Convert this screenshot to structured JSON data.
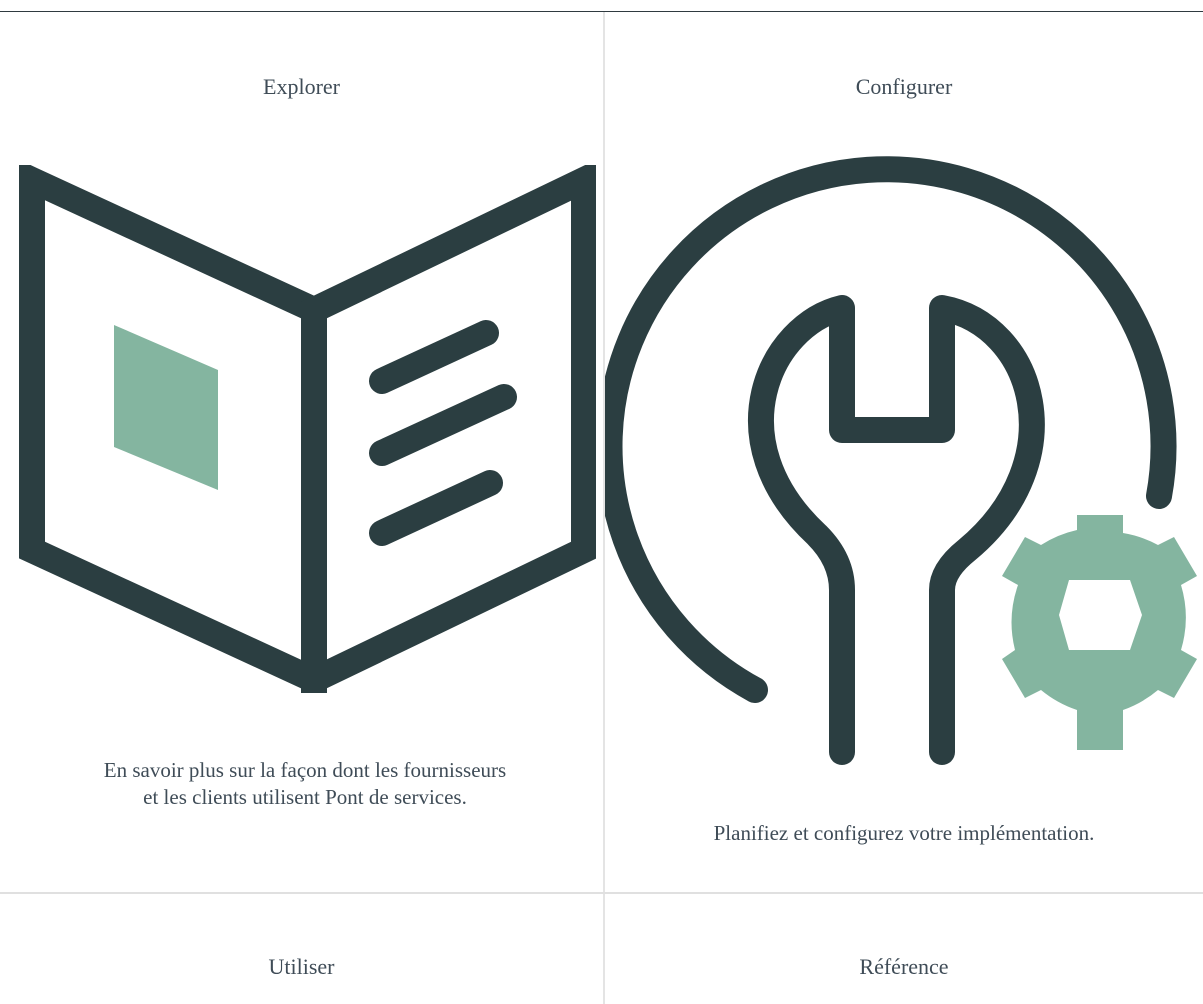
{
  "cards": [
    {
      "title": "Explorer",
      "description_line1": "En savoir plus sur la façon dont les fournisseurs",
      "description_line2": "et les clients utilisent Pont de services.",
      "icon": "open-book-icon"
    },
    {
      "title": "Configurer",
      "description": "Planifiez et configurez votre implémentation.",
      "icon": "wrench-gear-icon"
    },
    {
      "title": "Utiliser"
    },
    {
      "title": "Référence"
    }
  ],
  "colors": {
    "icon_dark": "#2b3e41",
    "icon_accent": "#84b5a0",
    "text": "#3f4c57",
    "divider": "#e0e0e0"
  }
}
